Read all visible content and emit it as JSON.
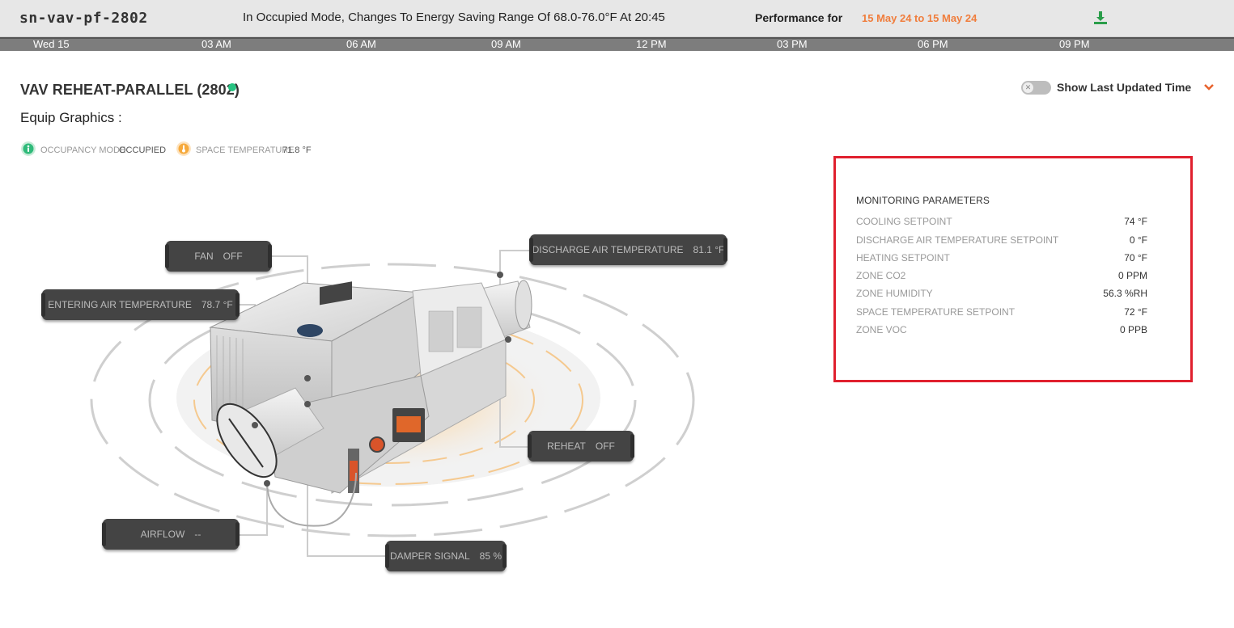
{
  "header": {
    "device_name": "sn-vav-pf-2802",
    "status_message": "In Occupied Mode, Changes To Energy Saving Range Of 68.0-76.0°F At 20:45",
    "performance_label": "Performance for",
    "performance_range": "15 May 24 to 15 May 24",
    "download_icon": "download-icon",
    "accent_color": "#f07d3c"
  },
  "timeline": {
    "ticks": [
      "Wed 15",
      "03 AM",
      "06 AM",
      "09 AM",
      "12 PM",
      "03 PM",
      "06 PM",
      "09 PM"
    ]
  },
  "equipment": {
    "title": "VAV REHEAT-PARALLEL (2802)",
    "status_color": "#27c281",
    "graphics_label": "Equip Graphics :",
    "toggle_label": "Show Last Updated Time",
    "toggle_on": false
  },
  "status_chips": {
    "occupancy_label": "OCCUPANCY MODE",
    "occupancy_value": "OCCUPIED",
    "space_temp_label": "SPACE TEMPERATURE",
    "space_temp_value": "71.8 °F"
  },
  "tags": {
    "fan": {
      "label": "FAN",
      "value": "OFF"
    },
    "entering_air": {
      "label": "ENTERING AIR TEMPERATURE",
      "value": "78.7 °F"
    },
    "discharge_air": {
      "label": "DISCHARGE AIR TEMPERATURE",
      "value": "81.1 °F"
    },
    "reheat": {
      "label": "REHEAT",
      "value": "OFF"
    },
    "airflow": {
      "label": "AIRFLOW",
      "value": "--"
    },
    "damper": {
      "label": "DAMPER SIGNAL",
      "value": "85 %"
    }
  },
  "monitoring": {
    "title": "MONITORING PARAMETERS",
    "rows": [
      {
        "label": "COOLING SETPOINT",
        "value": "74 °F"
      },
      {
        "label": "DISCHARGE AIR TEMPERATURE SETPOINT",
        "value": "0 °F"
      },
      {
        "label": "HEATING SETPOINT",
        "value": "70 °F"
      },
      {
        "label": "ZONE CO2",
        "value": "0 PPM"
      },
      {
        "label": "ZONE HUMIDITY",
        "value": "56.3 %RH"
      },
      {
        "label": "SPACE TEMPERATURE SETPOINT",
        "value": "72 °F"
      },
      {
        "label": "ZONE VOC",
        "value": "0 PPB"
      }
    ]
  }
}
